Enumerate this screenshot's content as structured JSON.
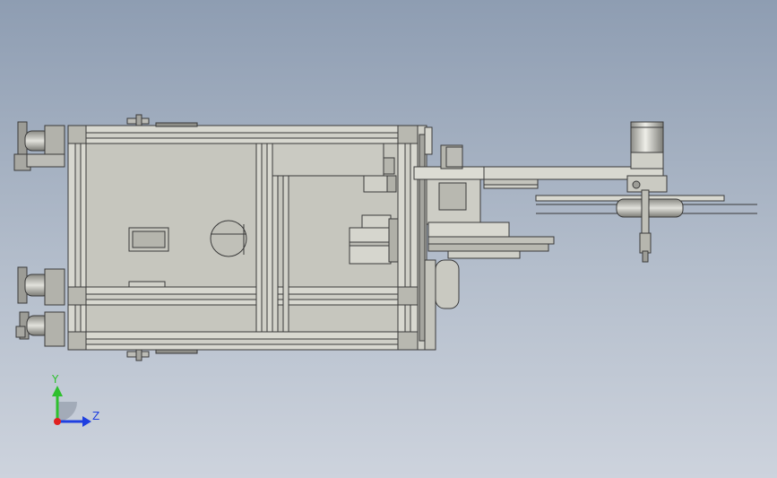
{
  "viewport": {
    "background_top": "#8e9db2",
    "background_bottom": "#cdd3dd"
  },
  "triad": {
    "y_label": "Y",
    "z_label": "Z",
    "y_color": "#2ec02e",
    "z_color": "#1f3fe0",
    "origin_color": "#e02020"
  },
  "colors": {
    "frame_fill": "#c9c9c1",
    "frame_stroke": "#3a3a3a",
    "profile_fill": "#d8d8d0",
    "motor_fill": "#bdbdb6"
  }
}
